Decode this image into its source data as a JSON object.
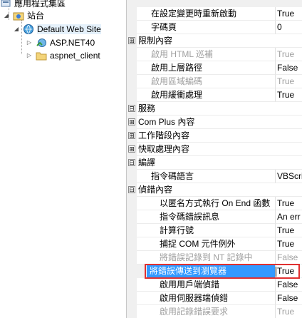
{
  "tree": {
    "items": [
      {
        "label": "應用程式集區",
        "icon": "app-pool-icon",
        "expander": ""
      },
      {
        "label": "站台",
        "icon": "sites-folder-icon",
        "expander": "◢"
      },
      {
        "label": "Default Web Site",
        "icon": "globe-icon",
        "expander": "◢"
      },
      {
        "label": "ASP.NET40",
        "icon": "web-app-icon",
        "expander": "▷"
      },
      {
        "label": "aspnet_client",
        "icon": "folder-icon",
        "expander": "▷"
      }
    ]
  },
  "grid": {
    "rows": [
      {
        "kind": "prop",
        "name": "在設定變更時重新啟動",
        "value": "True",
        "grey": false
      },
      {
        "kind": "prop",
        "name": "字碼頁",
        "value": "0",
        "grey": false
      },
      {
        "kind": "cat",
        "name": "限制內容",
        "toggle": "⊞"
      },
      {
        "kind": "prop",
        "name": "啟用 HTML 巡補",
        "value": "True",
        "grey": true
      },
      {
        "kind": "prop",
        "name": "啟用上層路徑",
        "value": "False",
        "grey": false
      },
      {
        "kind": "prop",
        "name": "啟用區域編碼",
        "value": "True",
        "grey": true
      },
      {
        "kind": "prop",
        "name": "啟用緩衝處理",
        "value": "True",
        "grey": false
      },
      {
        "kind": "cat",
        "name": "服務",
        "toggle": "⊟"
      },
      {
        "kind": "sub",
        "name": "Com Plus 內容",
        "toggle": "⊞"
      },
      {
        "kind": "sub",
        "name": "工作階段內容",
        "toggle": "⊞"
      },
      {
        "kind": "sub",
        "name": "快取處理內容",
        "toggle": "⊞"
      },
      {
        "kind": "cat",
        "name": "編譯",
        "toggle": "⊟"
      },
      {
        "kind": "prop",
        "name": "指令碼語言",
        "value": "VBScri",
        "grey": false
      },
      {
        "kind": "sub",
        "name": "偵錯內容",
        "toggle": "⊟"
      },
      {
        "kind": "prop2",
        "name": "以匿名方式執行 On End 函數",
        "value": "True",
        "grey": false
      },
      {
        "kind": "prop2",
        "name": "指令碼錯誤訊息",
        "value": "An err",
        "grey": false
      },
      {
        "kind": "prop2",
        "name": "計算行號",
        "value": "True",
        "grey": false
      },
      {
        "kind": "prop2",
        "name": "捕捉 COM 元件例外",
        "value": "True",
        "grey": false
      },
      {
        "kind": "prop2",
        "name": "將錯誤記錄到 NT 記錄中",
        "value": "False",
        "grey": true
      },
      {
        "kind": "prop2",
        "name": "將錯誤傳送到瀏覽器",
        "value": "True",
        "grey": false,
        "selected": true
      },
      {
        "kind": "prop2",
        "name": "啟用用戶端偵錯",
        "value": "False",
        "grey": false
      },
      {
        "kind": "prop2",
        "name": "啟用伺服器端偵錯",
        "value": "False",
        "grey": false
      },
      {
        "kind": "prop2",
        "name": "啟用記錄錯誤要求",
        "value": "True",
        "grey": true
      }
    ]
  }
}
